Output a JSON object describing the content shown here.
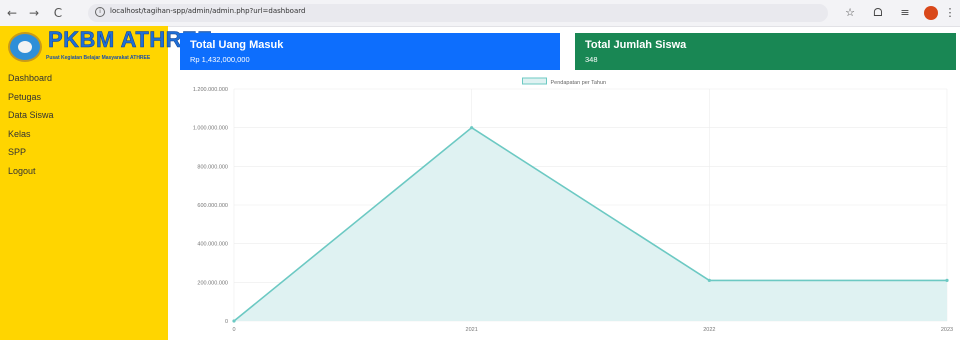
{
  "browser": {
    "back_icon": "←",
    "forward_icon": "→",
    "reload_icon": "C",
    "url": "localhost/tagihan-spp/admin/admin.php?url=dashboard",
    "icons": {
      "star": "☆",
      "extensions": "ᗝ",
      "media": "≡"
    }
  },
  "sidebar": {
    "logo_title": "PKBM ATHREE",
    "logo_subtitle": "Pusat Kegiatan Belajar Masyarakat ATHREE",
    "menu": [
      {
        "label": "Dashboard"
      },
      {
        "label": "Petugas"
      },
      {
        "label": "Data Siswa"
      },
      {
        "label": "Kelas"
      },
      {
        "label": "SPP"
      },
      {
        "label": "Logout"
      }
    ]
  },
  "cards": {
    "uang": {
      "title": "Total Uang Masuk",
      "value": "Rp 1,432,000,000",
      "color": "#0d6efd"
    },
    "siswa": {
      "title": "Total Jumlah Siswa",
      "value": "348",
      "color": "#198754"
    }
  },
  "chart_data": {
    "type": "line",
    "x": [
      "0",
      "2021",
      "2022",
      "2023"
    ],
    "series": [
      {
        "name": "Pendapatan per Tahun",
        "values": [
          0,
          1000000000,
          210000000,
          210000000
        ]
      }
    ],
    "yticks": [
      "0",
      "200.000.000",
      "400.000.000",
      "600.000.000",
      "800.000.000",
      "1.000.000.000",
      "1.200.000.000"
    ],
    "ylim": [
      0,
      1200000000
    ],
    "grid": true,
    "legend": "top-center",
    "line_color": "#6cc9c3",
    "fill_color": "#dff2f2"
  }
}
